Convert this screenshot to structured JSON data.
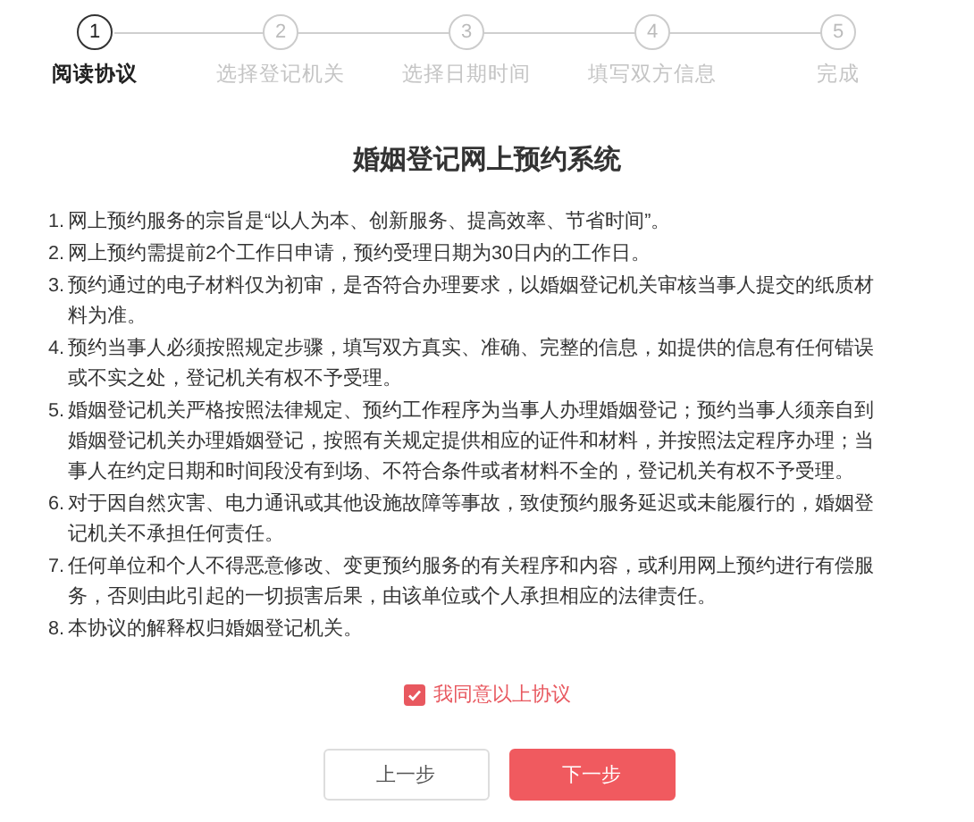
{
  "steps": [
    {
      "number": "1",
      "label": "阅读协议",
      "selected": true
    },
    {
      "number": "2",
      "label": "选择登记机关",
      "selected": false
    },
    {
      "number": "3",
      "label": "选择日期时间",
      "selected": false
    },
    {
      "number": "4",
      "label": "填写双方信息",
      "selected": false
    },
    {
      "number": "5",
      "label": "完成",
      "selected": false
    }
  ],
  "title": "婚姻登记网上预约系统",
  "terms": [
    {
      "number": "1.",
      "text": "网上预约服务的宗旨是“以人为本、创新服务、提高效率、节省时间”。"
    },
    {
      "number": "2.",
      "text": "网上预约需提前2个工作日申请，预约受理日期为30日内的工作日。"
    },
    {
      "number": "3.",
      "text": "预约通过的电子材料仅为初审，是否符合办理要求，以婚姻登记机关审核当事人提交的纸质材料为准。"
    },
    {
      "number": "4.",
      "text": "预约当事人必须按照规定步骤，填写双方真实、准确、完整的信息，如提供的信息有任何错误或不实之处，登记机关有权不予受理。"
    },
    {
      "number": "5.",
      "text": "婚姻登记机关严格按照法律规定、预约工作程序为当事人办理婚姻登记；预约当事人须亲自到婚姻登记机关办理婚姻登记，按照有关规定提供相应的证件和材料，并按照法定程序办理；当事人在约定日期和时间段没有到场、不符合条件或者材料不全的，登记机关有权不予受理。"
    },
    {
      "number": "6.",
      "text": "对于因自然灾害、电力通讯或其他设施故障等事故，致使预约服务延迟或未能履行的，婚姻登记机关不承担任何责任。"
    },
    {
      "number": "7.",
      "text": "任何单位和个人不得恶意修改、变更预约服务的有关程序和内容，或利用网上预约进行有偿服务，否则由此引起的一切损害后果，由该单位或个人承担相应的法律责任。"
    },
    {
      "number": "8.",
      "text": "本协议的解释权归婚姻登记机关。"
    }
  ],
  "agree": {
    "label": "我同意以上协议",
    "checked": true
  },
  "buttons": [
    {
      "label": "上一步",
      "kind": "secondary"
    },
    {
      "label": "下一步",
      "kind": "primary"
    }
  ]
}
